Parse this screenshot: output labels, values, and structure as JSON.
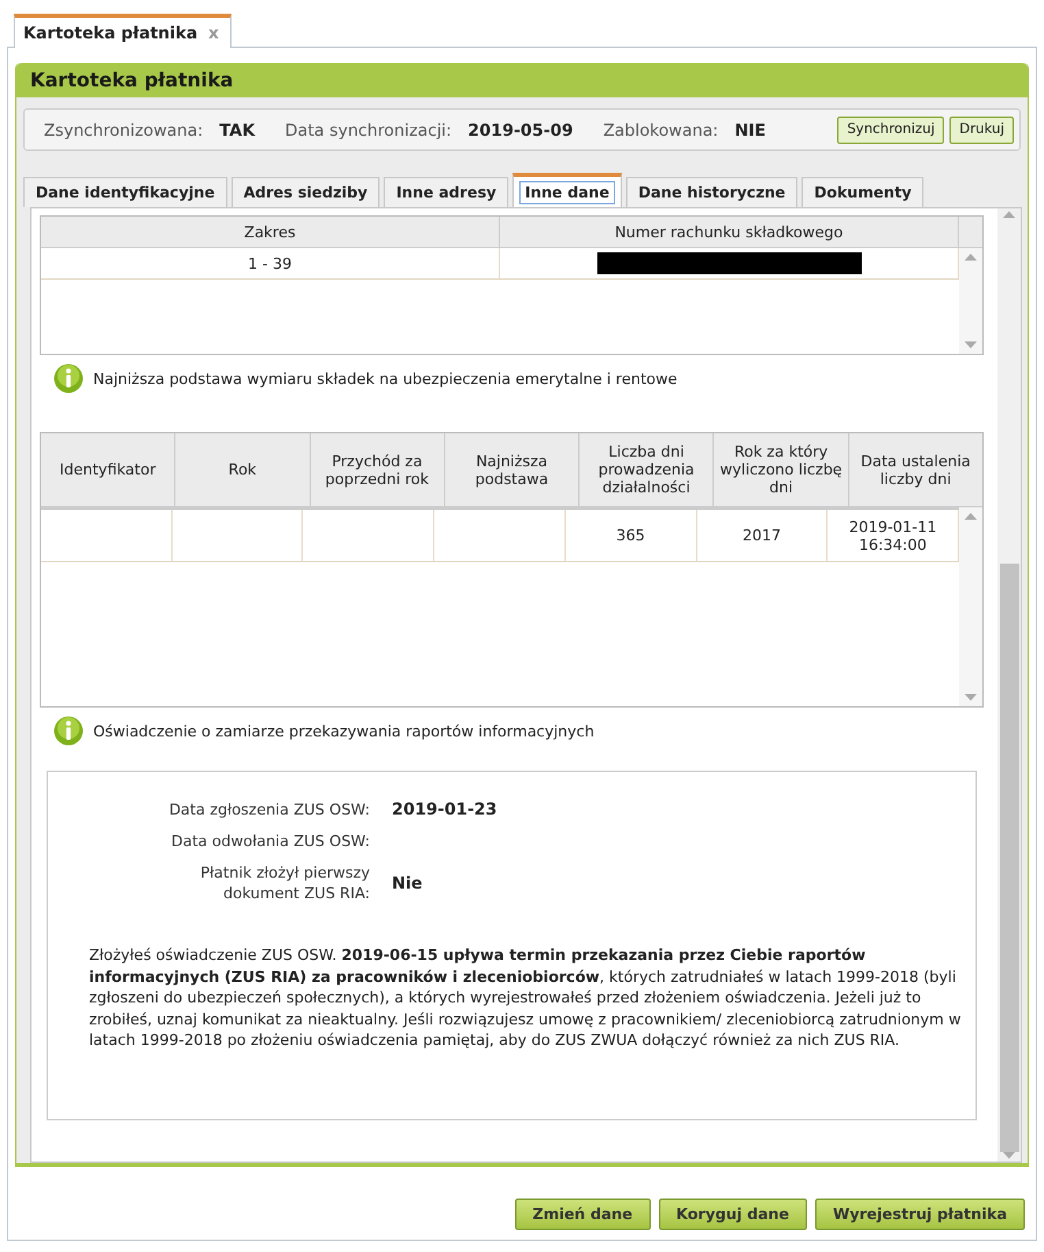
{
  "doc_tab": {
    "label": "Kartoteka płatnika",
    "close": "x"
  },
  "panel": {
    "title": "Kartoteka płatnika"
  },
  "sync_bar": {
    "fields": [
      {
        "label": "Zsynchronizowana:",
        "value": "TAK"
      },
      {
        "label": "Data synchronizacji:",
        "value": "2019-05-09"
      },
      {
        "label": "Zablokowana:",
        "value": "NIE"
      }
    ],
    "buttons": [
      "Synchronizuj",
      "Drukuj"
    ]
  },
  "tabs": [
    {
      "label": "Dane identyfikacyjne",
      "selected": false
    },
    {
      "label": "Adres siedziby",
      "selected": false
    },
    {
      "label": "Inne adresy",
      "selected": false
    },
    {
      "label": "Inne dane",
      "selected": true
    },
    {
      "label": "Dane historyczne",
      "selected": false
    },
    {
      "label": "Dokumenty",
      "selected": false
    }
  ],
  "accounts_table": {
    "columns": [
      "Zakres",
      "Numer rachunku składkowego"
    ],
    "rows": [
      [
        {
          "kind": "text",
          "text": "1 - 39"
        },
        {
          "kind": "redacted"
        }
      ]
    ]
  },
  "base_section": {
    "info": "Najniższa podstawa wymiaru składek na ubezpieczenia emerytalne i rentowe",
    "columns": [
      "Identyfikator",
      "Rok",
      "Przychód za poprzedni rok",
      "Najniższa podstawa",
      "Liczba dni prowadzenia działalności",
      "Rok za który wyliczono liczbę dni",
      "Data ustalenia liczby dni"
    ],
    "rows": [
      [
        null,
        null,
        null,
        null,
        "365",
        "2017",
        "2019-01-11 16:34:00"
      ]
    ]
  },
  "statement_section": {
    "info": "Oświadczenie o zamiarze przekazywania raportów informacyjnych",
    "fields": [
      {
        "label": "Data zgłoszenia ZUS OSW:",
        "value": "2019-01-23"
      },
      {
        "label": "Data odwołania ZUS OSW:"
      },
      {
        "label": "Płatnik złożył pierwszy dokument ZUS RIA:",
        "value": "Nie"
      }
    ],
    "message": "Złożyłeś oświadczenie ZUS OSW. **2019-06-15 upływa termin przekazania przez Ciebie raportów informacyjnych (ZUS RIA) za pracowników i zleceniobiorców**, których zatrudniałeś w latach 1999-2018 (byli zgłoszeni do ubezpieczeń społecznych), a których wyrejestrowałeś przed złożeniem oświadczenia. Jeżeli już to zrobiłeś, uznaj komunikat za nieaktualny. Jeśli rozwiązujesz umowę z pracownikiem/ zleceniobiorcą zatrudnionym w latach 1999-2018 po złożeniu oświadczenia pamiętaj, aby do ZUS ZWUA dołączyć również za nich ZUS RIA."
  },
  "actions": [
    "Zmień dane",
    "Koryguj dane",
    "Wyrejestruj płatnika"
  ]
}
